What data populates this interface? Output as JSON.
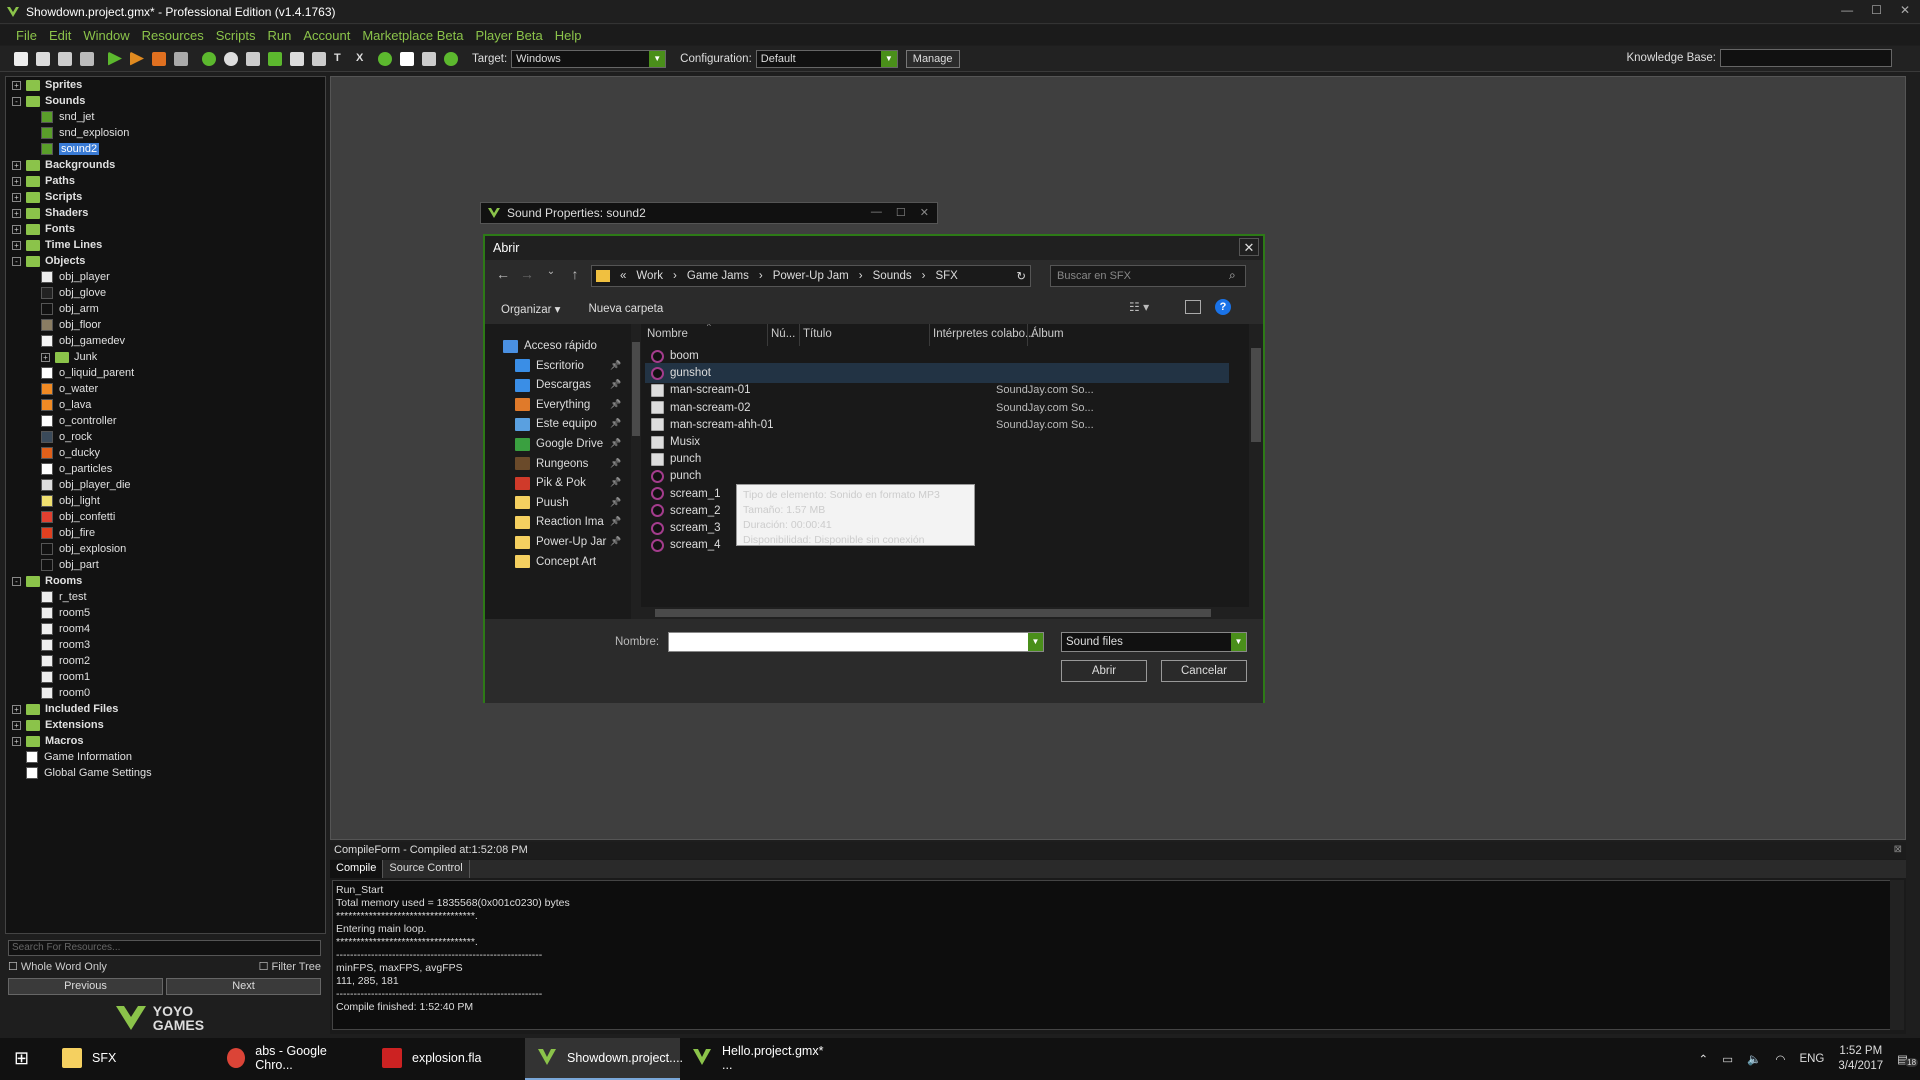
{
  "window": {
    "title": "Showdown.project.gmx*  -  Professional Edition (v1.4.1763)",
    "controls": [
      "—",
      "☐",
      "✕"
    ]
  },
  "menu": [
    "File",
    "Edit",
    "Window",
    "Resources",
    "Scripts",
    "Run",
    "Account",
    "Marketplace Beta",
    "Player Beta",
    "Help"
  ],
  "toolbar": {
    "target_label": "Target:",
    "target_value": "Windows",
    "config_label": "Configuration:",
    "config_value": "Default",
    "manage_label": "Manage",
    "kb_label": "Knowledge Base:"
  },
  "tree": [
    {
      "label": "Sprites",
      "level": 0,
      "type": "folder",
      "expand": "+"
    },
    {
      "label": "Sounds",
      "level": 0,
      "type": "folder",
      "expand": "-"
    },
    {
      "label": "snd_jet",
      "level": 1,
      "type": "sound"
    },
    {
      "label": "snd_explosion",
      "level": 1,
      "type": "sound"
    },
    {
      "label": "sound2",
      "level": 1,
      "type": "sound",
      "selected": true
    },
    {
      "label": "Backgrounds",
      "level": 0,
      "type": "folder",
      "expand": "+"
    },
    {
      "label": "Paths",
      "level": 0,
      "type": "folder",
      "expand": "+"
    },
    {
      "label": "Scripts",
      "level": 0,
      "type": "folder",
      "expand": "+"
    },
    {
      "label": "Shaders",
      "level": 0,
      "type": "folder",
      "expand": "+"
    },
    {
      "label": "Fonts",
      "level": 0,
      "type": "folder",
      "expand": "+"
    },
    {
      "label": "Time Lines",
      "level": 0,
      "type": "folder",
      "expand": "+"
    },
    {
      "label": "Objects",
      "level": 0,
      "type": "folder",
      "expand": "-"
    },
    {
      "label": "obj_player",
      "level": 1,
      "type": "obj",
      "color": "#eeeeee"
    },
    {
      "label": "obj_glove",
      "level": 1,
      "type": "obj",
      "color": "#222222"
    },
    {
      "label": "obj_arm",
      "level": 1,
      "type": "obj",
      "color": "#111111"
    },
    {
      "label": "obj_floor",
      "level": 1,
      "type": "obj",
      "color": "#8a7d63"
    },
    {
      "label": "obj_gamedev",
      "level": 1,
      "type": "obj",
      "color": "#f5f5f5"
    },
    {
      "label": "Junk",
      "level": 1,
      "type": "folder",
      "expand": "+"
    },
    {
      "label": "o_liquid_parent",
      "level": 1,
      "type": "obj",
      "color": "#ffffff"
    },
    {
      "label": "o_water",
      "level": 1,
      "type": "obj",
      "color": "#f08a24"
    },
    {
      "label": "o_lava",
      "level": 1,
      "type": "obj",
      "color": "#f08a24"
    },
    {
      "label": "o_controller",
      "level": 1,
      "type": "obj",
      "color": "#ffffff"
    },
    {
      "label": "o_rock",
      "level": 1,
      "type": "obj",
      "color": "#3a4a5a"
    },
    {
      "label": "o_ducky",
      "level": 1,
      "type": "obj",
      "color": "#e0601a"
    },
    {
      "label": "o_particles",
      "level": 1,
      "type": "obj",
      "color": "#ffffff"
    },
    {
      "label": "obj_player_die",
      "level": 1,
      "type": "obj",
      "color": "#dddddd"
    },
    {
      "label": "obj_light",
      "level": 1,
      "type": "obj",
      "color": "#f0e070"
    },
    {
      "label": "obj_confetti",
      "level": 1,
      "type": "obj",
      "color": "#e04030"
    },
    {
      "label": "obj_fire",
      "level": 1,
      "type": "obj",
      "color": "#e04020"
    },
    {
      "label": "obj_explosion",
      "level": 1,
      "type": "obj",
      "color": "#111111"
    },
    {
      "label": "obj_part",
      "level": 1,
      "type": "obj",
      "color": "#111111"
    },
    {
      "label": "Rooms",
      "level": 0,
      "type": "folder",
      "expand": "-"
    },
    {
      "label": "r_test",
      "level": 1,
      "type": "room"
    },
    {
      "label": "room5",
      "level": 1,
      "type": "room"
    },
    {
      "label": "room4",
      "level": 1,
      "type": "room"
    },
    {
      "label": "room3",
      "level": 1,
      "type": "room"
    },
    {
      "label": "room2",
      "level": 1,
      "type": "room"
    },
    {
      "label": "room1",
      "level": 1,
      "type": "room"
    },
    {
      "label": "room0",
      "level": 1,
      "type": "room"
    },
    {
      "label": "Included Files",
      "level": 0,
      "type": "folder",
      "expand": "+"
    },
    {
      "label": "Extensions",
      "level": 0,
      "type": "folder",
      "expand": "+"
    },
    {
      "label": "Macros",
      "level": 0,
      "type": "folder",
      "expand": "+"
    },
    {
      "label": "Game Information",
      "level": 0,
      "type": "file"
    },
    {
      "label": "Global Game Settings",
      "level": 0,
      "type": "file"
    }
  ],
  "leftpanel": {
    "search_placeholder": "Search For Resources...",
    "whole_word": "Whole Word Only",
    "filter_tree": "Filter Tree",
    "previous": "Previous",
    "next": "Next",
    "logo_text": "YOYO GAMES"
  },
  "sound_window": {
    "title": "Sound Properties: sound2",
    "controls": [
      "—",
      "☐",
      "✕"
    ]
  },
  "dialog": {
    "title": "Abrir",
    "close": "✕",
    "address": [
      "«",
      "Work",
      "›",
      "Game Jams",
      "›",
      "Power-Up Jam",
      "›",
      "Sounds",
      "›",
      "SFX"
    ],
    "search_placeholder": "Buscar en SFX",
    "organize": "Organizar ▾",
    "new_folder": "Nueva carpeta",
    "nav_items": [
      {
        "label": "Acceso rápido",
        "color": "#4a90e2",
        "pin": false
      },
      {
        "label": "Escritorio",
        "color": "#3a8ee6",
        "pin": true
      },
      {
        "label": "Descargas",
        "color": "#3a8ee6",
        "pin": true
      },
      {
        "label": "Everything",
        "color": "#e07a2a",
        "pin": true
      },
      {
        "label": "Este equipo",
        "color": "#5aa0e0",
        "pin": true
      },
      {
        "label": "Google Drive",
        "color": "#3aa040",
        "pin": true
      },
      {
        "label": "Rungeons",
        "color": "#6a4a2a",
        "pin": true
      },
      {
        "label": "Pik & Pok",
        "color": "#d03a2a",
        "pin": true
      },
      {
        "label": "Puush",
        "color": "#f5d060",
        "pin": true
      },
      {
        "label": "Reaction Ima",
        "color": "#f5d060",
        "pin": true
      },
      {
        "label": "Power-Up Jar",
        "color": "#f5d060",
        "pin": true
      },
      {
        "label": "Concept Art",
        "color": "#f5d060",
        "pin": false
      }
    ],
    "columns": [
      "Nombre",
      "Nú...",
      "Título",
      "Intérpretes colabo...",
      "Álbum"
    ],
    "files": [
      {
        "name": "boom",
        "artist": "",
        "icon": "audio"
      },
      {
        "name": "gunshot",
        "artist": "",
        "icon": "audio",
        "highlight": true
      },
      {
        "name": "man-scream-01",
        "artist": "SoundJay.com So...",
        "icon": "doc"
      },
      {
        "name": "man-scream-02",
        "artist": "SoundJay.com So...",
        "icon": "doc"
      },
      {
        "name": "man-scream-ahh-01",
        "artist": "SoundJay.com So...",
        "icon": "doc"
      },
      {
        "name": "Musix",
        "artist": "",
        "icon": "doc"
      },
      {
        "name": "punch",
        "artist": "",
        "icon": "doc"
      },
      {
        "name": "punch",
        "artist": "",
        "icon": "audio"
      },
      {
        "name": "scream_1",
        "artist": "",
        "icon": "audio"
      },
      {
        "name": "scream_2",
        "artist": "",
        "icon": "audio"
      },
      {
        "name": "scream_3",
        "artist": "",
        "icon": "audio"
      },
      {
        "name": "scream_4",
        "artist": "",
        "icon": "audio"
      }
    ],
    "tooltip": [
      "Tipo de elemento: Sonido en formato MP3",
      "Tamaño: 1.57 MB",
      "Duración: 00:00:41",
      "Disponibilidad: Disponible sin conexión"
    ],
    "name_label": "Nombre:",
    "name_value": "",
    "filetype": "Sound files",
    "open_btn": "Abrir",
    "cancel_btn": "Cancelar"
  },
  "compile": {
    "header": "CompileForm - Compiled at:1:52:08 PM",
    "tabs": [
      "Compile",
      "Source Control"
    ],
    "output": "Run_Start\nTotal memory used = 1835568(0x001c0230) bytes\n**********************************.\nEntering main loop.\n**********************************.\n-----------------------------------------------------------\nminFPS, maxFPS, avgFPS\n111, 285, 181\n-----------------------------------------------------------\nCompile finished: 1:52:40 PM"
  },
  "taskbar": {
    "items": [
      {
        "label": "",
        "icon": "windows-icon",
        "color": "#ffffff"
      },
      {
        "label": "SFX",
        "icon": "folder-icon",
        "color": "#f5d060"
      },
      {
        "label": "abs - Google Chro...",
        "icon": "chrome-icon",
        "color": "#db4437"
      },
      {
        "label": "explosion.fla",
        "icon": "flash-icon",
        "color": "#cc2222"
      },
      {
        "label": "Showdown.project....",
        "icon": "gamemaker-icon",
        "color": "#8bc34a",
        "active": true
      },
      {
        "label": "Hello.project.gmx* ...",
        "icon": "gamemaker-icon",
        "color": "#8bc34a"
      }
    ],
    "lang": "ENG",
    "time": "1:52 PM",
    "date": "3/4/2017",
    "notif": "18"
  }
}
